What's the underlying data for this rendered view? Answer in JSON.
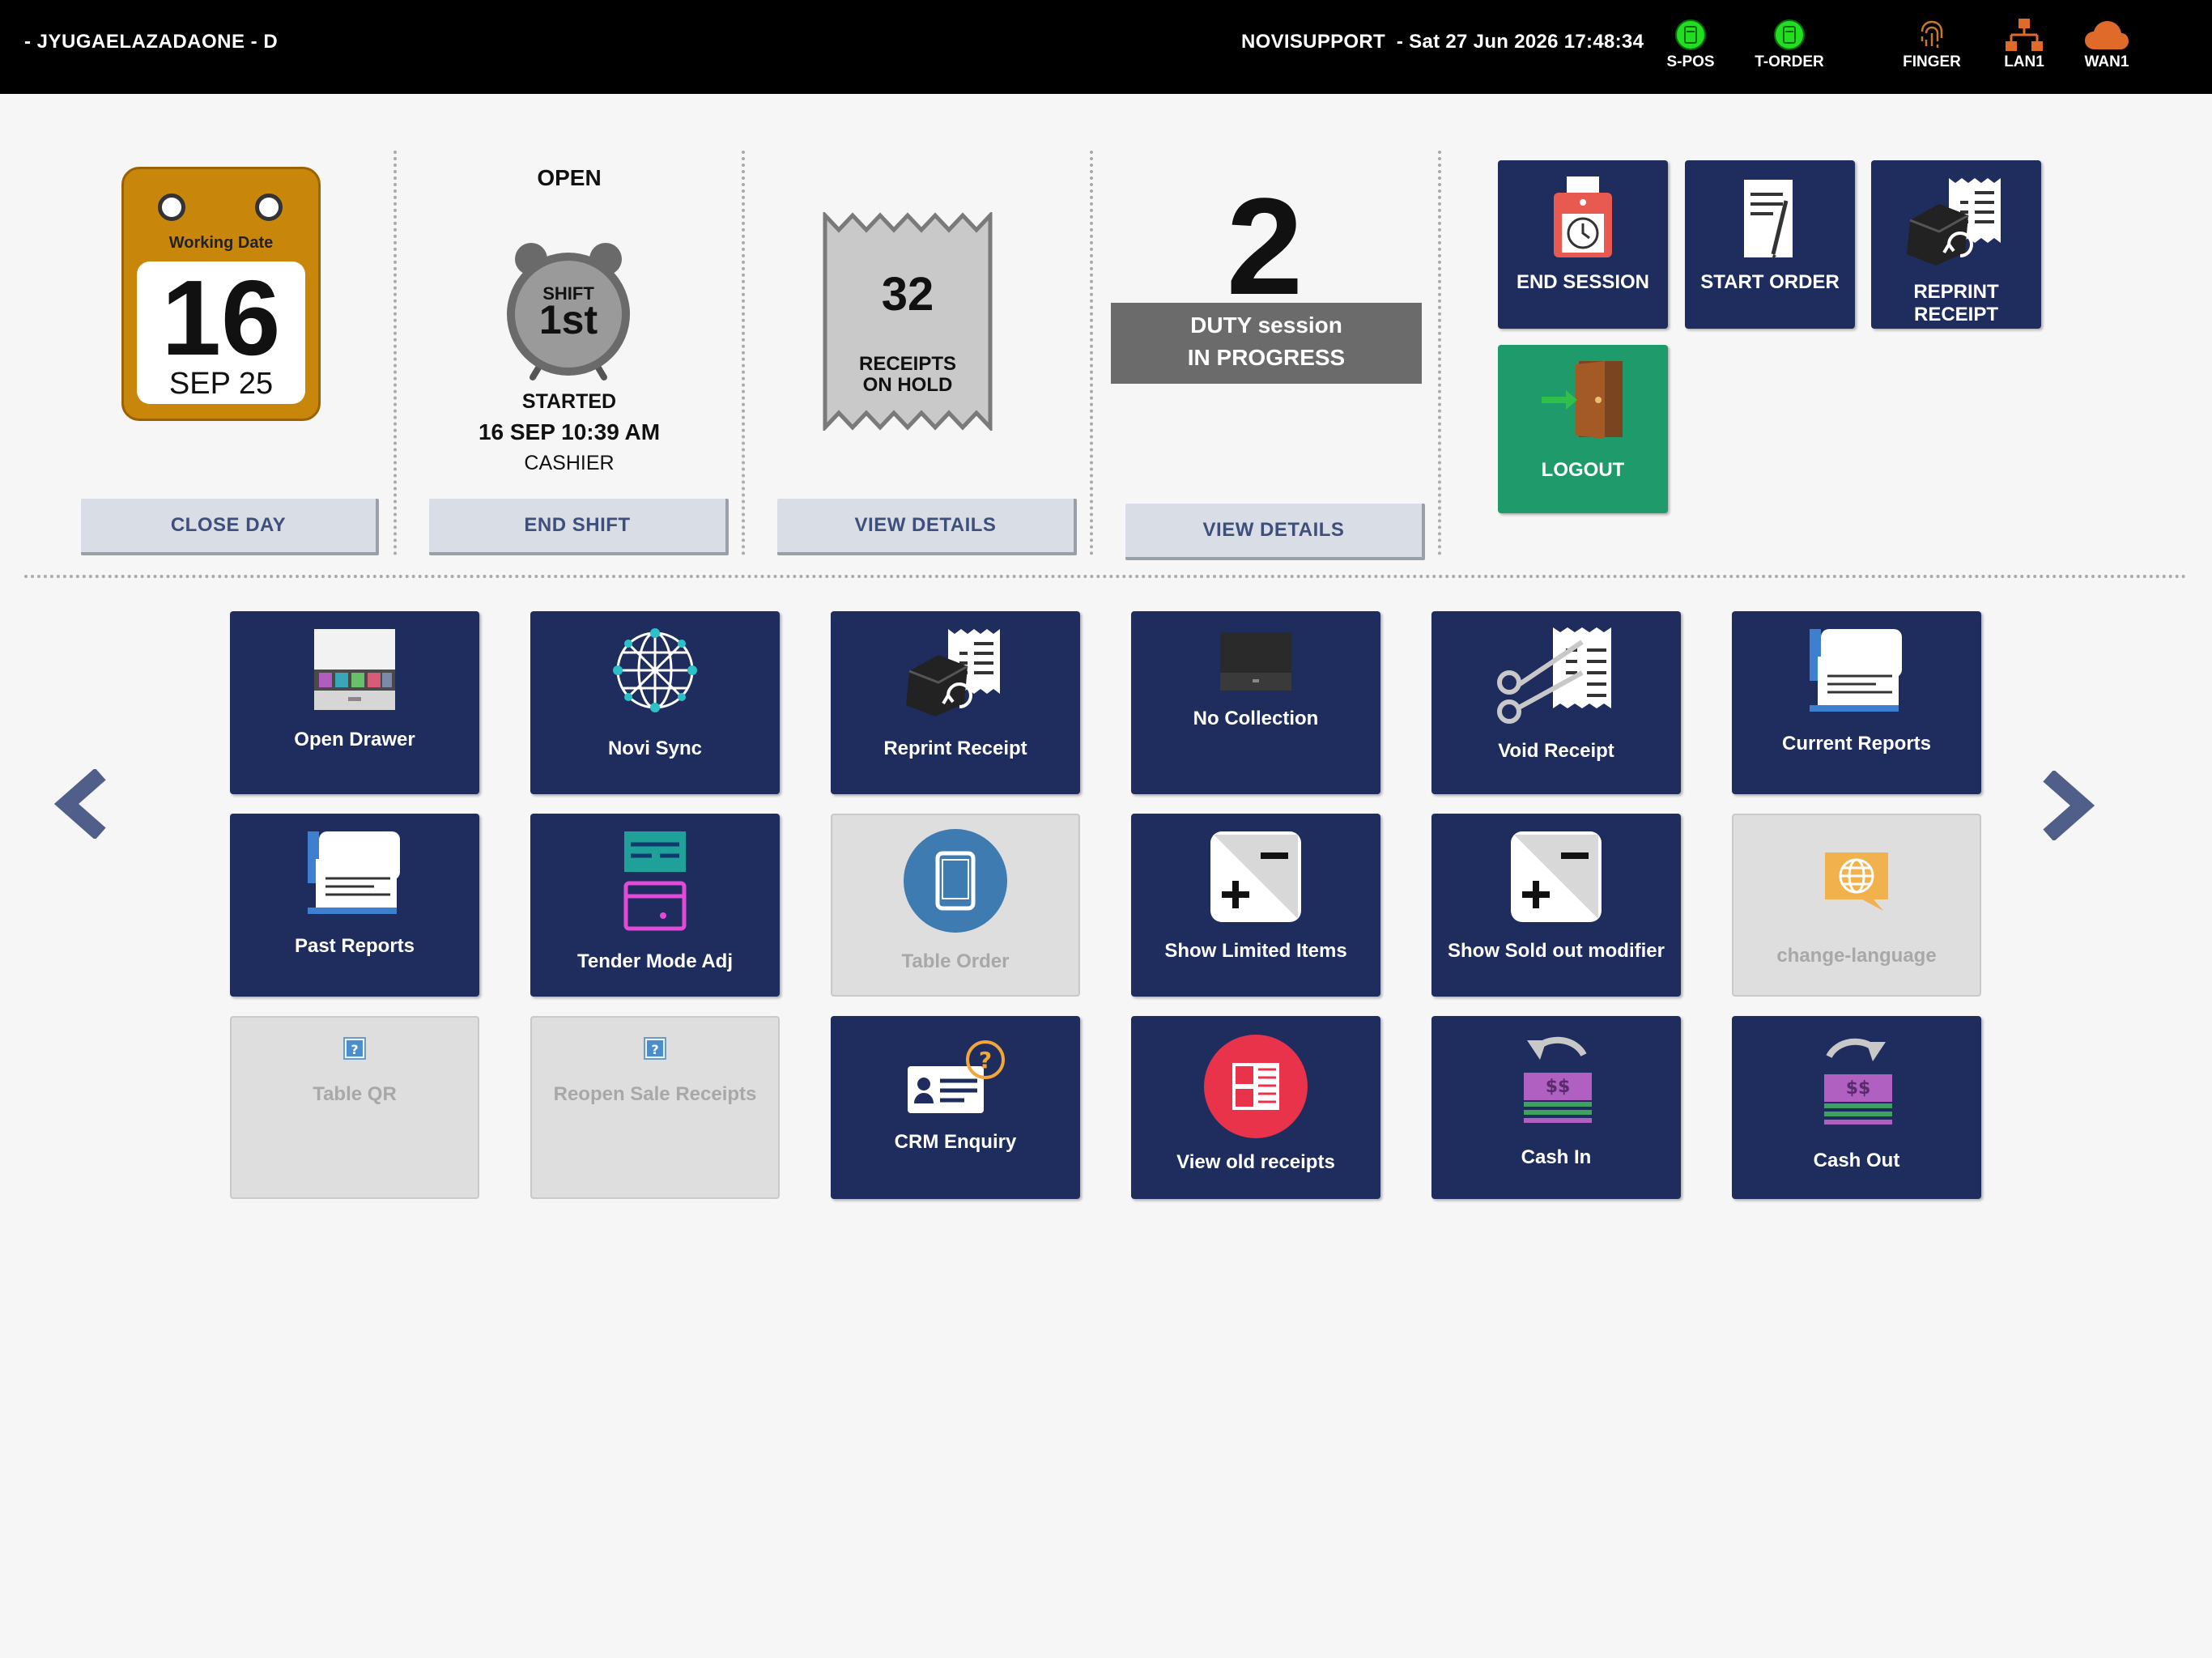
{
  "header": {
    "terminal": "- JYUGAELAZADAONE - D",
    "user_datetime": "NOVISUPPORT  - Sat 27 Jun 2026 17:48:34",
    "status": [
      {
        "label": "S-POS",
        "icon": "printer-online-icon",
        "color": "#22dd22"
      },
      {
        "label": "T-ORDER",
        "icon": "printer-online-icon",
        "color": "#22dd22"
      },
      {
        "label": "FINGER",
        "icon": "fingerprint-icon",
        "color": "#c57a2a"
      },
      {
        "label": "LAN1",
        "icon": "network-icon",
        "color": "#e06a2a"
      },
      {
        "label": "WAN1",
        "icon": "cloud-icon",
        "color": "#e06a2a"
      }
    ]
  },
  "day": {
    "working_date_label": "Working Date",
    "day": "16",
    "month_year": "SEP 25",
    "close_label": "CLOSE DAY"
  },
  "shift": {
    "status": "OPEN",
    "badge_top": "SHIFT",
    "badge_number": "1st",
    "started_label": "STARTED",
    "started_at": "16 SEP 10:39 AM",
    "role": "CASHIER",
    "end_label": "END SHIFT"
  },
  "receipts_hold": {
    "count": "32",
    "line1": "RECEIPTS",
    "line2": "ON HOLD",
    "view_label": "VIEW DETAILS"
  },
  "duty": {
    "count": "2",
    "line1": "DUTY session",
    "line2": "IN PROGRESS",
    "view_label": "VIEW DETAILS"
  },
  "quick_actions": {
    "end_session": "END SESSION",
    "start_order": "START ORDER",
    "reprint_receipt_line1": "REPRINT",
    "reprint_receipt_line2": "RECEIPT",
    "logout": "LOGOUT"
  },
  "grid": {
    "open_drawer": "Open Drawer",
    "novi_sync": "Novi Sync",
    "reprint_receipt": "Reprint Receipt",
    "no_collection": "No Collection",
    "void_receipt": "Void Receipt",
    "current_reports": "Current Reports",
    "past_reports": "Past Reports",
    "tender_mode_adj": "Tender Mode Adj",
    "table_order": "Table Order",
    "show_limited_items": "Show Limited Items",
    "show_sold_out_modifier": "Show Sold out modifier",
    "change_language": "change-language",
    "table_qr": "Table QR",
    "reopen_sale_receipts": "Reopen Sale Receipts",
    "crm_enquiry": "CRM Enquiry",
    "view_old_receipts": "View old receipts",
    "cash_in": "Cash In",
    "cash_out": "Cash Out",
    "cash_symbol": "$$"
  },
  "colors": {
    "tile_blue": "#1e2d5e",
    "tile_green": "#1f9a6a",
    "tile_disabled": "#dedede"
  }
}
